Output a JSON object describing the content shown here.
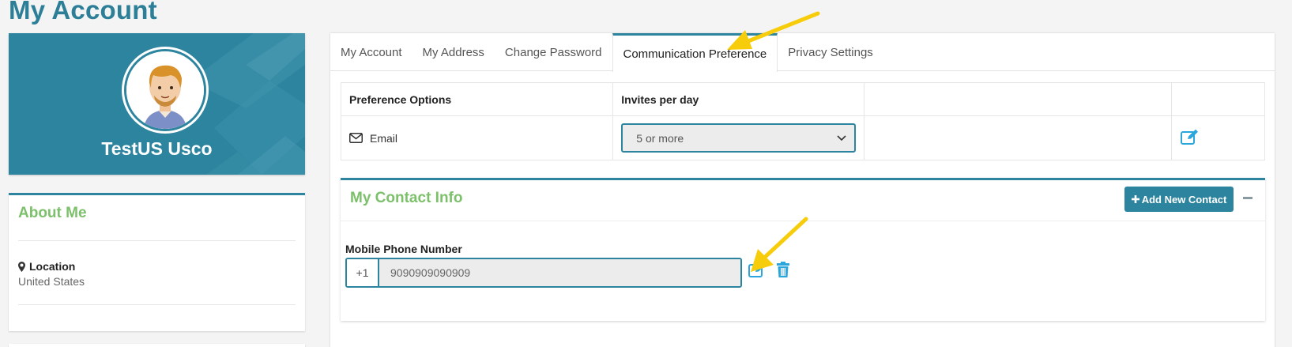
{
  "page": {
    "title": "My Account"
  },
  "profile": {
    "name": "TestUS Usco"
  },
  "about": {
    "title": "About Me",
    "location_label": "Location",
    "location_value": "United States"
  },
  "tabs": [
    {
      "label": "My Account",
      "active": false
    },
    {
      "label": "My Address",
      "active": false
    },
    {
      "label": "Change Password",
      "active": false
    },
    {
      "label": "Communication Preference",
      "active": true
    },
    {
      "label": "Privacy Settings",
      "active": false
    }
  ],
  "preferences": {
    "header_options": "Preference Options",
    "header_invites": "Invites per day",
    "row_email_label": "Email",
    "row_email_selected": "5 or more"
  },
  "contact": {
    "title": "My Contact Info",
    "add_button_label": "Add New Contact",
    "phone_label": "Mobile Phone Number",
    "phone_prefix": "+1",
    "phone_value": "9090909090909"
  },
  "colors": {
    "brand": "#2d849e",
    "section_title": "#7cc06b",
    "icon_blue": "#2ba6dd",
    "annotation_arrow": "#f6cc0b"
  },
  "icons": {
    "location": "map-marker-icon",
    "email": "envelope-icon",
    "dropdown": "chevron-down-icon",
    "edit": "edit-icon",
    "delete": "trash-icon",
    "add": "plus-icon",
    "collapse": "minus-icon"
  }
}
